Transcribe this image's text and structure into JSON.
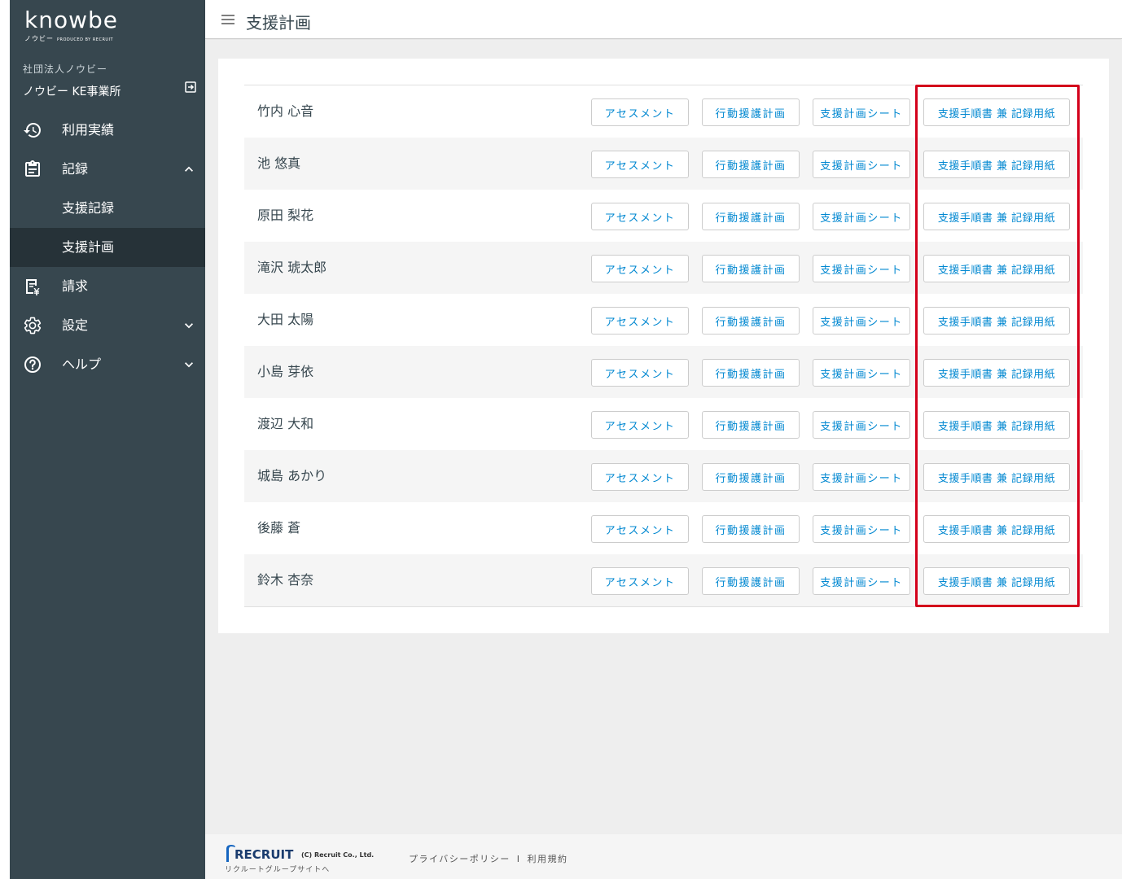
{
  "sidebar": {
    "logo_main": "knowbe",
    "logo_sub": "ノウビー",
    "logo_produced": "PRODUCED BY RECRUIT",
    "org_name": "社団法人ノウビー",
    "office_name": "ノウビー KE事業所",
    "items": [
      {
        "label": "利用実績",
        "icon": "history-icon"
      },
      {
        "label": "記録",
        "icon": "clipboard-icon",
        "expanded": true
      },
      {
        "label": "支援記録",
        "sub": true
      },
      {
        "label": "支援計画",
        "sub": true,
        "active": true
      },
      {
        "label": "請求",
        "icon": "invoice-yen-icon"
      },
      {
        "label": "設定",
        "icon": "gear-icon",
        "expanded": false
      },
      {
        "label": "ヘルプ",
        "icon": "help-icon",
        "expanded": false
      }
    ]
  },
  "header": {
    "title": "支援計画"
  },
  "buttons": {
    "assessment": "アセスメント",
    "behavior_plan": "行動援護計画",
    "plan_sheet": "支援計画シート",
    "procedure_record": "支援手順書 兼 記録用紙"
  },
  "users": [
    {
      "name": "竹内 心音"
    },
    {
      "name": "池 悠真"
    },
    {
      "name": "原田 梨花"
    },
    {
      "name": "滝沢 琥太郎"
    },
    {
      "name": "大田 太陽"
    },
    {
      "name": "小島 芽依"
    },
    {
      "name": "渡辺 大和"
    },
    {
      "name": "城島 あかり"
    },
    {
      "name": "後藤 蒼"
    },
    {
      "name": "鈴木 杏奈"
    }
  ],
  "footer": {
    "recruit": "RECRUIT",
    "copyright": "(C) Recruit Co., Ltd.",
    "group_link": "リクルートグループサイトへ",
    "privacy": "プライバシーポリシー",
    "separator": "I",
    "terms": "利用規約"
  },
  "colors": {
    "sidebar_bg": "#37474f",
    "sidebar_active": "#263238",
    "accent": "#0288d1",
    "highlight": "#d3001b"
  }
}
